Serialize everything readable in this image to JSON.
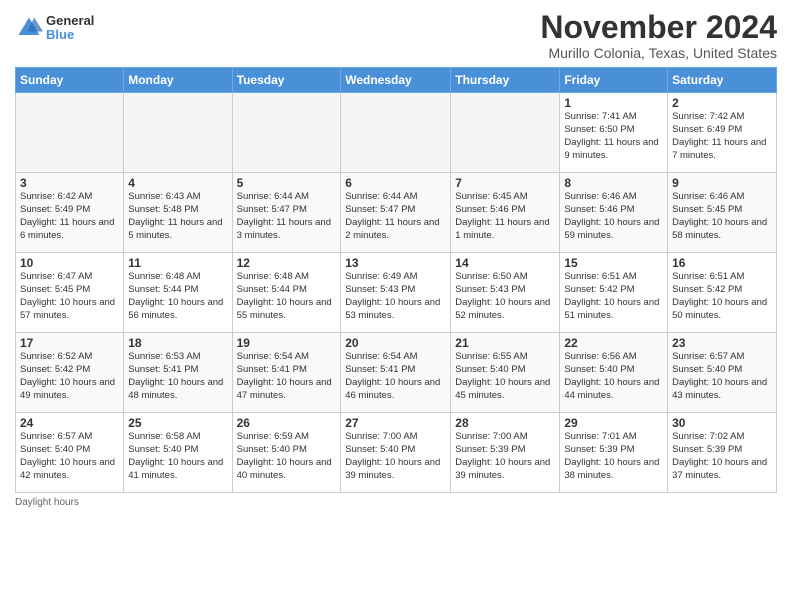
{
  "header": {
    "logo": {
      "general": "General",
      "blue": "Blue"
    },
    "title": "November 2024",
    "location": "Murillo Colonia, Texas, United States"
  },
  "calendar": {
    "weekdays": [
      "Sunday",
      "Monday",
      "Tuesday",
      "Wednesday",
      "Thursday",
      "Friday",
      "Saturday"
    ],
    "weeks": [
      [
        {
          "day": "",
          "info": ""
        },
        {
          "day": "",
          "info": ""
        },
        {
          "day": "",
          "info": ""
        },
        {
          "day": "",
          "info": ""
        },
        {
          "day": "",
          "info": ""
        },
        {
          "day": "1",
          "info": "Sunrise: 7:41 AM\nSunset: 6:50 PM\nDaylight: 11 hours and 9 minutes."
        },
        {
          "day": "2",
          "info": "Sunrise: 7:42 AM\nSunset: 6:49 PM\nDaylight: 11 hours and 7 minutes."
        }
      ],
      [
        {
          "day": "3",
          "info": "Sunrise: 6:42 AM\nSunset: 5:49 PM\nDaylight: 11 hours and 6 minutes."
        },
        {
          "day": "4",
          "info": "Sunrise: 6:43 AM\nSunset: 5:48 PM\nDaylight: 11 hours and 5 minutes."
        },
        {
          "day": "5",
          "info": "Sunrise: 6:44 AM\nSunset: 5:47 PM\nDaylight: 11 hours and 3 minutes."
        },
        {
          "day": "6",
          "info": "Sunrise: 6:44 AM\nSunset: 5:47 PM\nDaylight: 11 hours and 2 minutes."
        },
        {
          "day": "7",
          "info": "Sunrise: 6:45 AM\nSunset: 5:46 PM\nDaylight: 11 hours and 1 minute."
        },
        {
          "day": "8",
          "info": "Sunrise: 6:46 AM\nSunset: 5:46 PM\nDaylight: 10 hours and 59 minutes."
        },
        {
          "day": "9",
          "info": "Sunrise: 6:46 AM\nSunset: 5:45 PM\nDaylight: 10 hours and 58 minutes."
        }
      ],
      [
        {
          "day": "10",
          "info": "Sunrise: 6:47 AM\nSunset: 5:45 PM\nDaylight: 10 hours and 57 minutes."
        },
        {
          "day": "11",
          "info": "Sunrise: 6:48 AM\nSunset: 5:44 PM\nDaylight: 10 hours and 56 minutes."
        },
        {
          "day": "12",
          "info": "Sunrise: 6:48 AM\nSunset: 5:44 PM\nDaylight: 10 hours and 55 minutes."
        },
        {
          "day": "13",
          "info": "Sunrise: 6:49 AM\nSunset: 5:43 PM\nDaylight: 10 hours and 53 minutes."
        },
        {
          "day": "14",
          "info": "Sunrise: 6:50 AM\nSunset: 5:43 PM\nDaylight: 10 hours and 52 minutes."
        },
        {
          "day": "15",
          "info": "Sunrise: 6:51 AM\nSunset: 5:42 PM\nDaylight: 10 hours and 51 minutes."
        },
        {
          "day": "16",
          "info": "Sunrise: 6:51 AM\nSunset: 5:42 PM\nDaylight: 10 hours and 50 minutes."
        }
      ],
      [
        {
          "day": "17",
          "info": "Sunrise: 6:52 AM\nSunset: 5:42 PM\nDaylight: 10 hours and 49 minutes."
        },
        {
          "day": "18",
          "info": "Sunrise: 6:53 AM\nSunset: 5:41 PM\nDaylight: 10 hours and 48 minutes."
        },
        {
          "day": "19",
          "info": "Sunrise: 6:54 AM\nSunset: 5:41 PM\nDaylight: 10 hours and 47 minutes."
        },
        {
          "day": "20",
          "info": "Sunrise: 6:54 AM\nSunset: 5:41 PM\nDaylight: 10 hours and 46 minutes."
        },
        {
          "day": "21",
          "info": "Sunrise: 6:55 AM\nSunset: 5:40 PM\nDaylight: 10 hours and 45 minutes."
        },
        {
          "day": "22",
          "info": "Sunrise: 6:56 AM\nSunset: 5:40 PM\nDaylight: 10 hours and 44 minutes."
        },
        {
          "day": "23",
          "info": "Sunrise: 6:57 AM\nSunset: 5:40 PM\nDaylight: 10 hours and 43 minutes."
        }
      ],
      [
        {
          "day": "24",
          "info": "Sunrise: 6:57 AM\nSunset: 5:40 PM\nDaylight: 10 hours and 42 minutes."
        },
        {
          "day": "25",
          "info": "Sunrise: 6:58 AM\nSunset: 5:40 PM\nDaylight: 10 hours and 41 minutes."
        },
        {
          "day": "26",
          "info": "Sunrise: 6:59 AM\nSunset: 5:40 PM\nDaylight: 10 hours and 40 minutes."
        },
        {
          "day": "27",
          "info": "Sunrise: 7:00 AM\nSunset: 5:40 PM\nDaylight: 10 hours and 39 minutes."
        },
        {
          "day": "28",
          "info": "Sunrise: 7:00 AM\nSunset: 5:39 PM\nDaylight: 10 hours and 39 minutes."
        },
        {
          "day": "29",
          "info": "Sunrise: 7:01 AM\nSunset: 5:39 PM\nDaylight: 10 hours and 38 minutes."
        },
        {
          "day": "30",
          "info": "Sunrise: 7:02 AM\nSunset: 5:39 PM\nDaylight: 10 hours and 37 minutes."
        }
      ]
    ]
  },
  "footer": {
    "note": "Daylight hours"
  }
}
